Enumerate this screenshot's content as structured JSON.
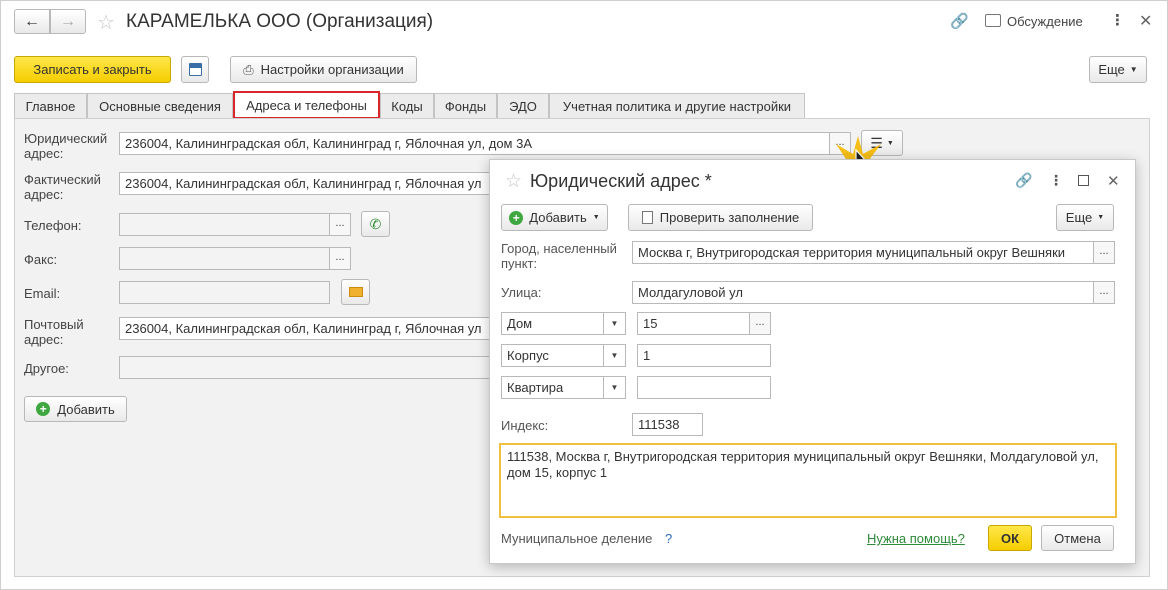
{
  "window": {
    "title": "КАРАМЕЛЬКА ООО (Организация)",
    "discussion_label": "Обсуждение"
  },
  "toolbar": {
    "save_close": "Записать и закрыть",
    "org_settings": "Настройки организации",
    "more": "Еще"
  },
  "tabs": [
    {
      "label": "Главное"
    },
    {
      "label": "Основные сведения"
    },
    {
      "label": "Адреса и телефоны"
    },
    {
      "label": "Коды"
    },
    {
      "label": "Фонды"
    },
    {
      "label": "ЭДО"
    },
    {
      "label": "Учетная политика и другие настройки"
    }
  ],
  "form": {
    "legal_label": "Юридический адрес:",
    "legal_value": "236004, Калининградская обл, Калининград г, Яблочная ул, дом 3А",
    "actual_label": "Фактический адрес:",
    "actual_value": "236004, Калининградская обл, Калининград г, Яблочная ул",
    "phone_label": "Телефон:",
    "fax_label": "Факс:",
    "email_label": "Email:",
    "postal_label": "Почтовый адрес:",
    "postal_value": "236004, Калининградская обл, Калининград г, Яблочная ул",
    "other_label": "Другое:",
    "add_button": "Добавить"
  },
  "dialog": {
    "title": "Юридический адрес *",
    "add_button": "Добавить",
    "check_button": "Проверить заполнение",
    "more": "Еще",
    "city_label": "Город, населенный пункт:",
    "city_value": "Москва г, Внутригородская территория муниципальный округ Вешняки",
    "street_label": "Улица:",
    "street_value": "Молдагуловой ул",
    "house_type": "Дом",
    "house_value": "15",
    "building_type": "Корпус",
    "building_value": "1",
    "flat_type": "Квартира",
    "flat_value": "",
    "index_label": "Индекс:",
    "index_value": "111538",
    "full_address": "111538, Москва г, Внутригородская территория муниципальный округ Вешняки, Молдагуловой ул, дом 15, корпус 1",
    "municipal_label": "Муниципальное деление",
    "municipal_help": "?",
    "help_link": "Нужна помощь?",
    "ok": "ОК",
    "cancel": "Отмена"
  },
  "colors": {
    "accent_yellow": "#f5cd00",
    "active_tab_border": "#d9262c",
    "focus_border": "#f0c040",
    "link_green": "#2f8a3a"
  }
}
